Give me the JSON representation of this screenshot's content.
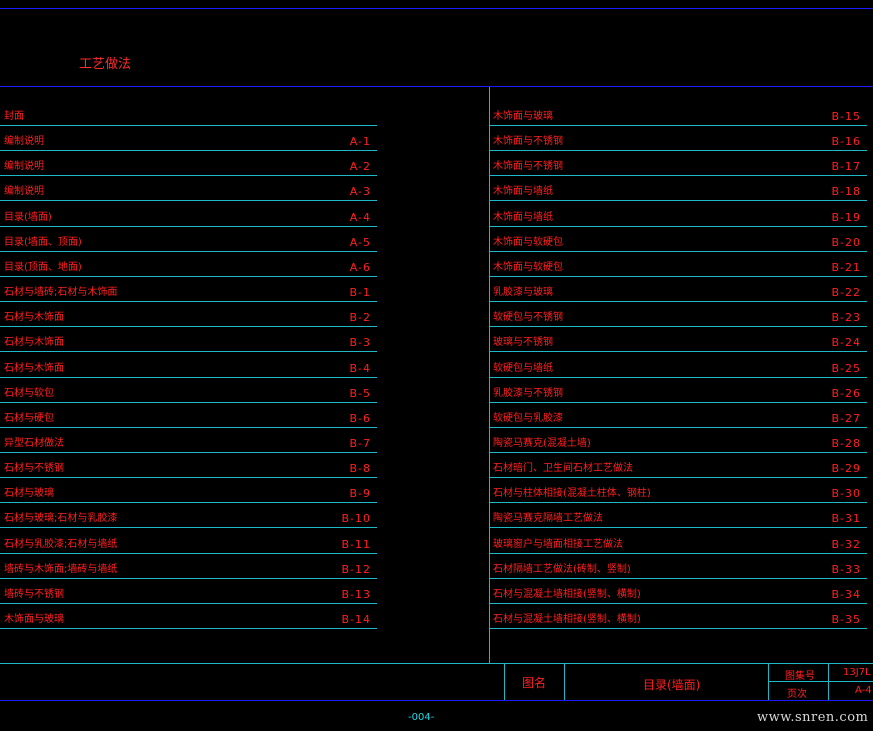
{
  "header": {
    "title": "工艺做法"
  },
  "left_column": [
    {
      "title": "封面",
      "code": ""
    },
    {
      "title": "编制说明",
      "code": "A-1"
    },
    {
      "title": "编制说明",
      "code": "A-2"
    },
    {
      "title": "编制说明",
      "code": "A-3"
    },
    {
      "title": "目录(墙面)",
      "code": "A-4"
    },
    {
      "title": "目录(墙面、顶面)",
      "code": "A-5"
    },
    {
      "title": "目录(顶面、地面)",
      "code": "A-6"
    },
    {
      "title": "石材与墙砖;石材与木饰面",
      "code": "B-1"
    },
    {
      "title": "石材与木饰面",
      "code": "B-2"
    },
    {
      "title": "石材与木饰面",
      "code": "B-3"
    },
    {
      "title": "石材与木饰面",
      "code": "B-4"
    },
    {
      "title": "石材与软包",
      "code": "B-5"
    },
    {
      "title": "石材与硬包",
      "code": "B-6"
    },
    {
      "title": "异型石材做法",
      "code": "B-7"
    },
    {
      "title": "石材与不锈钢",
      "code": "B-8"
    },
    {
      "title": "石材与玻璃",
      "code": "B-9"
    },
    {
      "title": "石材与玻璃;石材与乳胶漆",
      "code": "B-10"
    },
    {
      "title": "石材与乳胶漆;石材与墙纸",
      "code": "B-11"
    },
    {
      "title": "墙砖与木饰面;墙砖与墙纸",
      "code": "B-12"
    },
    {
      "title": "墙砖与不锈钢",
      "code": "B-13"
    },
    {
      "title": "木饰面与玻璃",
      "code": "B-14"
    }
  ],
  "right_column": [
    {
      "title": "木饰面与玻璃",
      "code": "B-15"
    },
    {
      "title": "木饰面与不锈钢",
      "code": "B-16"
    },
    {
      "title": "木饰面与不锈钢",
      "code": "B-17"
    },
    {
      "title": "木饰面与墙纸",
      "code": "B-18"
    },
    {
      "title": "木饰面与墙纸",
      "code": "B-19"
    },
    {
      "title": "木饰面与软硬包",
      "code": "B-20"
    },
    {
      "title": "木饰面与软硬包",
      "code": "B-21"
    },
    {
      "title": "乳胶漆与玻璃",
      "code": "B-22"
    },
    {
      "title": "软硬包与不锈钢",
      "code": "B-23"
    },
    {
      "title": "玻璃与不锈钢",
      "code": "B-24"
    },
    {
      "title": "软硬包与墙纸",
      "code": "B-25"
    },
    {
      "title": "乳胶漆与不锈钢",
      "code": "B-26"
    },
    {
      "title": "软硬包与乳胶漆",
      "code": "B-27"
    },
    {
      "title": "陶瓷马赛克(混凝土墙)",
      "code": "B-28"
    },
    {
      "title": "石材暗门、卫生间石材工艺做法",
      "code": "B-29"
    },
    {
      "title": "石材与柱体相接(混凝土柱体、钢柱)",
      "code": "B-30"
    },
    {
      "title": "陶瓷马赛克隔墙工艺做法",
      "code": "B-31"
    },
    {
      "title": "玻璃窗户与墙面相接工艺做法",
      "code": "B-32"
    },
    {
      "title": "石材隔墙工艺做法(砖制、竖制)",
      "code": "B-33"
    },
    {
      "title": "石材与混凝土墙相接(竖制、横制)",
      "code": "B-34"
    },
    {
      "title": "石材与混凝土墙相接(竖制、横制)",
      "code": "B-35"
    }
  ],
  "title_block": {
    "drawing_name_label": "图名",
    "drawing_name": "目录(墙面)",
    "atlas_no_label": "图集号",
    "atlas_no": "13J7L",
    "page_label": "页次",
    "page": "A-4"
  },
  "footer": {
    "page_no": "-004-",
    "watermark": "www.snren.com"
  },
  "colors": {
    "background": "#000000",
    "text": "#ff2020",
    "rule_line": "#1fb8c8",
    "frame_line": "#1a1aff",
    "page_no": "#1fd8e8"
  }
}
